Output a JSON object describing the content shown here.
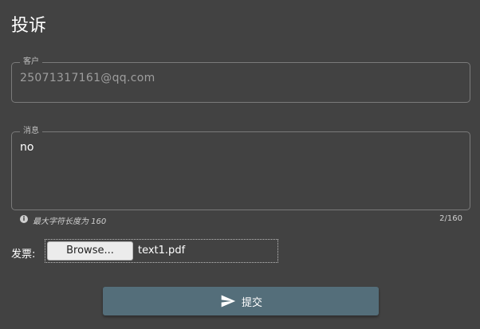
{
  "page": {
    "title": "投诉"
  },
  "customer": {
    "legend": "客户",
    "value": "25071317161@qq.com"
  },
  "message": {
    "legend": "消息",
    "value": "no",
    "hint": "最大字符长度为 160",
    "counter": "2/160"
  },
  "invoice": {
    "label": "发票:",
    "browse_label": "Browse...",
    "file_name": "text1.pdf"
  },
  "submit": {
    "label": "提交",
    "icon": "send-icon"
  },
  "colors": {
    "background": "#424242",
    "accent": "#546e7a"
  }
}
